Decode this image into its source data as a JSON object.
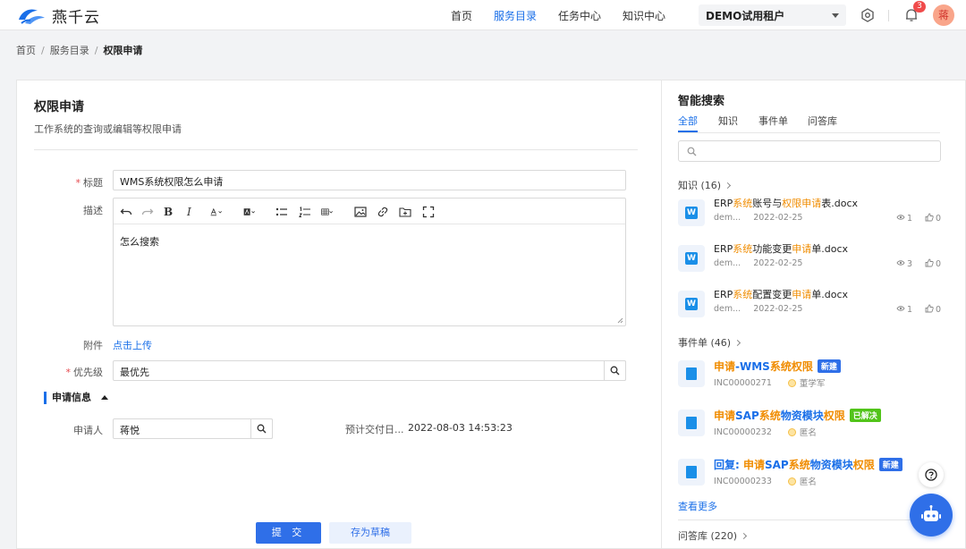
{
  "header": {
    "brand": "燕千云",
    "nav": [
      {
        "label": "首页"
      },
      {
        "label": "服务目录",
        "active": true
      },
      {
        "label": "任务中心"
      },
      {
        "label": "知识中心"
      }
    ],
    "tenant": "DEMO试用租户",
    "notification_count": "3",
    "avatar_text": "蒋"
  },
  "breadcrumb": {
    "items": [
      "首页",
      "服务目录",
      "权限申请"
    ]
  },
  "form": {
    "title": "权限申请",
    "description": "工作系统的查询或编辑等权限申请",
    "fields": {
      "title_label": "标题",
      "title_value": "WMS系统权限怎么申请",
      "desc_label": "描述",
      "desc_value": "怎么搜索",
      "attachment_label": "附件",
      "attachment_link": "点击上传",
      "priority_label": "优先级",
      "priority_value": "最优先"
    },
    "section": "申请信息",
    "applicant_label": "申请人",
    "applicant_value": "蒋悦",
    "delivery_label": "预计交付日...",
    "delivery_value": "2022-08-03 14:53:23",
    "submit_label": "提 交",
    "draft_label": "存为草稿"
  },
  "smart_search": {
    "title": "智能搜索",
    "tabs": [
      {
        "label": "全部",
        "active": true
      },
      {
        "label": "知识"
      },
      {
        "label": "事件单"
      },
      {
        "label": "问答库"
      }
    ],
    "knowledge": {
      "header": "知识 (16)",
      "items": [
        {
          "parts": [
            [
              "ERP",
              false
            ],
            [
              "系统",
              true
            ],
            [
              "账号与",
              false
            ],
            [
              "权限申请",
              true
            ],
            [
              "表.docx",
              false
            ]
          ],
          "author": "dem...",
          "date": "2022-02-25",
          "views": "1",
          "likes": "0"
        },
        {
          "parts": [
            [
              "ERP",
              false
            ],
            [
              "系统",
              true
            ],
            [
              "功能变更",
              false
            ],
            [
              "申请",
              true
            ],
            [
              "单.docx",
              false
            ]
          ],
          "author": "dem...",
          "date": "2022-02-25",
          "views": "3",
          "likes": "0"
        },
        {
          "parts": [
            [
              "ERP",
              false
            ],
            [
              "系统",
              true
            ],
            [
              "配置变更",
              false
            ],
            [
              "申请",
              true
            ],
            [
              "单.docx",
              false
            ]
          ],
          "author": "dem...",
          "date": "2022-02-25",
          "views": "1",
          "likes": "0"
        }
      ]
    },
    "incidents": {
      "header": "事件单 (46)",
      "items": [
        {
          "parts": [
            [
              "申请",
              true
            ],
            [
              "-WMS",
              false
            ],
            [
              "系统权限",
              true
            ]
          ],
          "tag": "新建",
          "tag_type": "new",
          "code": "INC00000271",
          "user": "董学军"
        },
        {
          "parts": [
            [
              "申请",
              true
            ],
            [
              "SAP",
              false
            ],
            [
              "系统",
              true
            ],
            [
              "物资模块",
              false
            ],
            [
              "权限",
              true
            ]
          ],
          "tag": "已解决",
          "tag_type": "done",
          "code": "INC00000232",
          "user": "匿名"
        },
        {
          "parts": [
            [
              "回复: ",
              false
            ],
            [
              "申请",
              true
            ],
            [
              "SAP",
              false
            ],
            [
              "系统",
              true
            ],
            [
              "物资模块",
              false
            ],
            [
              "权限",
              true
            ]
          ],
          "tag": "新建",
          "tag_type": "new",
          "code": "INC00000233",
          "user": "匿名"
        }
      ]
    },
    "more_label": "查看更多",
    "qa_header": "问答库 (220)"
  },
  "colors": {
    "primary": "#1a6fe8",
    "highlight": "#f08c00",
    "danger": "#e5484d",
    "success": "#52c41a"
  }
}
